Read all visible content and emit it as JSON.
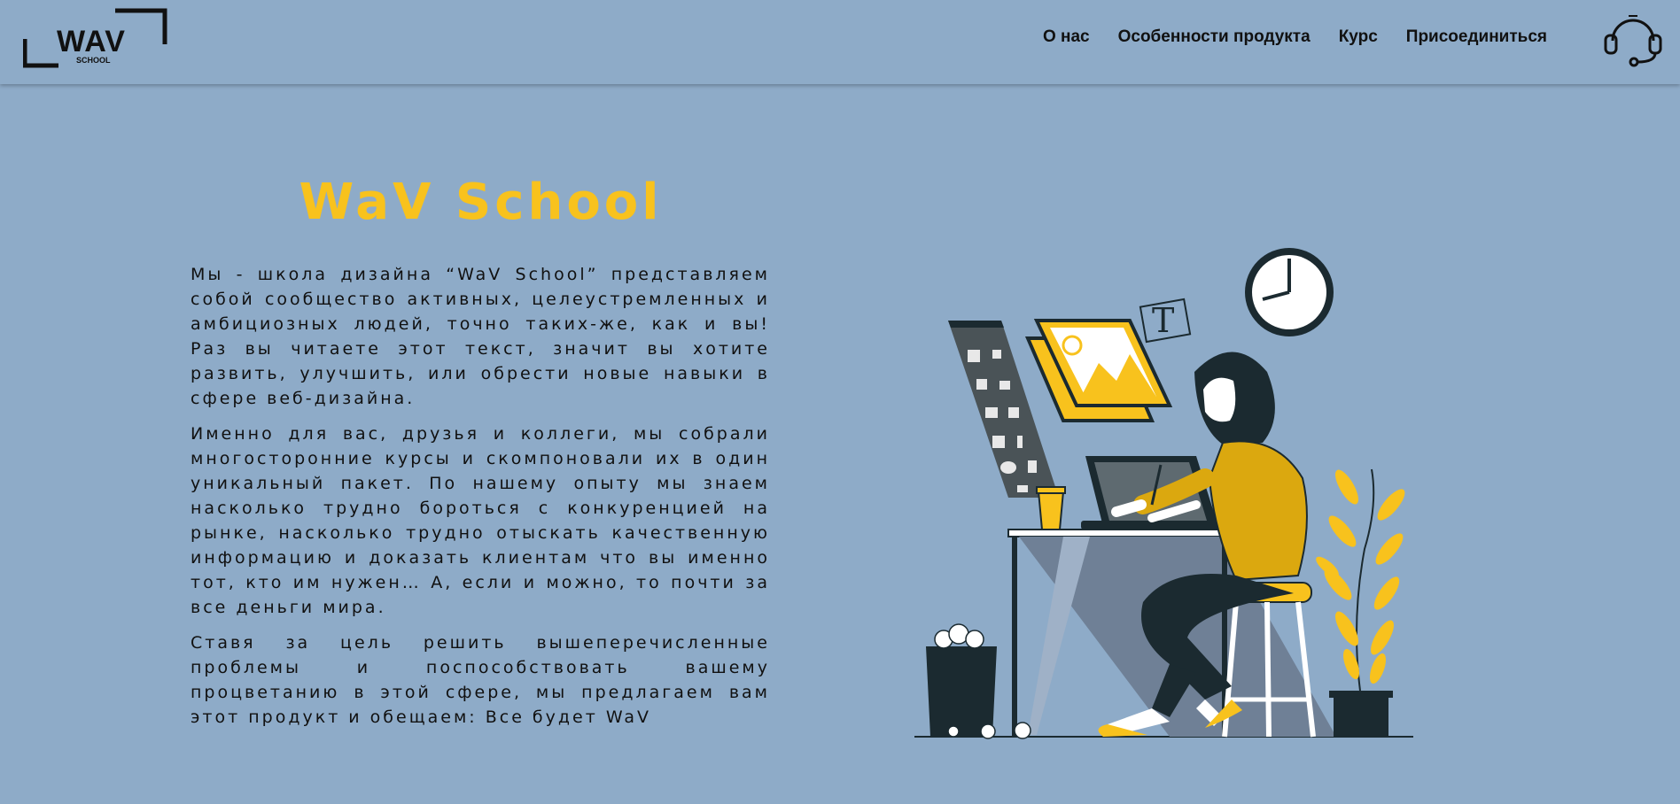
{
  "logo": {
    "text": "WAV",
    "subtext": "SCHOOL"
  },
  "nav": {
    "items": [
      {
        "label": "О нас"
      },
      {
        "label": "Особенности продукта"
      },
      {
        "label": "Курс"
      },
      {
        "label": "Присоединиться"
      }
    ]
  },
  "support": {
    "icon": "headset-icon"
  },
  "hero": {
    "title": "WaV School",
    "paragraphs": [
      "Мы - школа дизайна “WaV School” представляем собой сообщество активных, целеустремленных и амбициозных людей, точно таких-же, как и вы! Раз вы читаете этот текст, значит вы хотите развить, улучшить, или обрести новые навыки в сфере веб-дизайна.",
      "Именно для вас, друзья и коллеги, мы собрали многосторонние курсы и скомпоновали их в один уникальный пакет. По нашему опыту мы знаем насколько трудно бороться с конкуренцией на рынке, насколько трудно отыскать качественную информацию и доказать клиентам что вы именно тот, кто им нужен… А, если и можно, то почти за все деньги мира.",
      "Ставя за цель решить вышеперечисленные проблемы и поспособствовать вашему процветанию в этой сфере, мы предлагаем вам этот продукт и обещаем: Все будет WaV"
    ],
    "illustration": "designer-at-desk-illustration"
  },
  "colors": {
    "background": "#8eabc8",
    "accent": "#f8c21d",
    "dark": "#1b2a30"
  }
}
